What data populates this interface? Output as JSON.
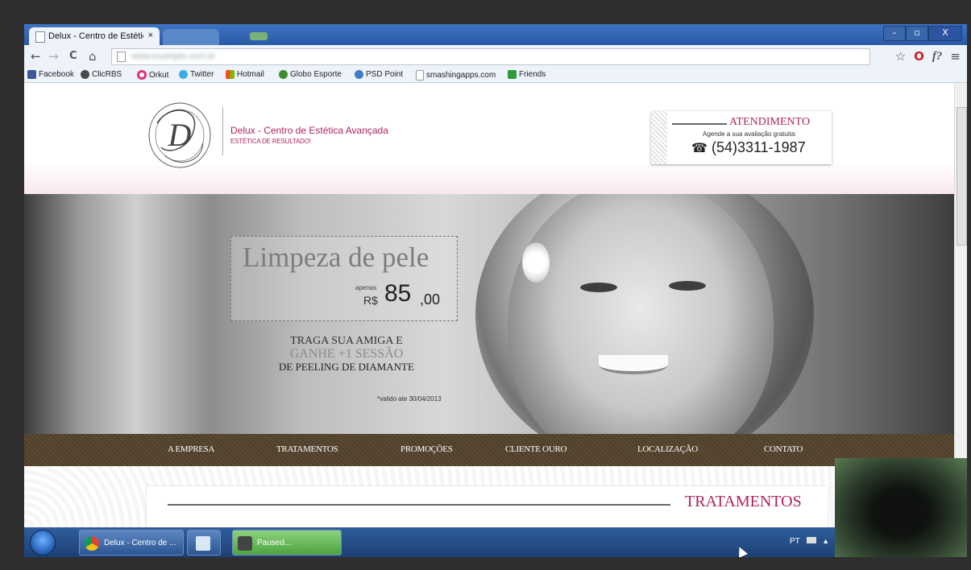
{
  "browser": {
    "tab_title": "Delux - Centro de Estétic",
    "tab_close": "×",
    "window_buttons": {
      "minimize": "–",
      "maximize": "▫",
      "close": "X"
    },
    "nav": {
      "back": "←",
      "forward": "→",
      "reload": "C",
      "home": "⌂"
    },
    "url_blurred": "www.example.com.br",
    "toolbar_icons": {
      "star": "☆",
      "opera": "O",
      "fx": "f?",
      "menu": "≡"
    }
  },
  "bookmarks": [
    {
      "label": "Facebook",
      "color": "#3b5998"
    },
    {
      "label": "ClicRBS",
      "color": "#4a4a4a"
    },
    {
      "label": "Orkut",
      "color": "#e0307a"
    },
    {
      "label": "Twitter",
      "color": "#3aaee8"
    },
    {
      "label": "Hotmail",
      "color": "#f0a020"
    },
    {
      "label": "Globo Esporte",
      "color": "#3f8c2e"
    },
    {
      "label": "PSD Point",
      "color": "#3f7dc8"
    },
    {
      "label": "smashingapps.com",
      "color": "#ffffff"
    },
    {
      "label": "Friends",
      "color": "#2e9a3a"
    }
  ],
  "site": {
    "brand": "Delux - Centro de Estética Avançada",
    "tagline": "ESTÉTICA DE RESULTADO!",
    "logo_letter": "D",
    "atendimento": {
      "heading": "ATENDIMENTO",
      "subtitle": "Agende a sua avaliação gratuita:",
      "phone_icon": "☎",
      "phone": "(54)3311-1987"
    },
    "promo": {
      "title": "Limpeza de pele",
      "apenas": "apenas",
      "currency": "R$",
      "price": "85",
      "cents": ",00"
    },
    "offer": {
      "line1": "TRAGA SUA AMIGA E",
      "line2": "GANHE +1 SESSÃO",
      "line3": "DE PEELING DE DIAMANTE"
    },
    "validity": "*valido ate 30/04/2013",
    "menu": [
      "A EMPRESA",
      "TRATAMENTOS",
      "PROMOÇÕES",
      "CLIENTE OURO",
      "LOCALIZAÇÃO",
      "CONTATO"
    ],
    "section_title": "TRATAMENTOS"
  },
  "taskbar": {
    "chrome_task": "Delux - Centro de ...",
    "paused_task": "Paused...",
    "tray_lang": "PT",
    "tray_arrow": "▴"
  },
  "colors": {
    "accent": "#b0245e",
    "nav_brown": "#5b4a34",
    "titlebar": "#2b5aa6"
  }
}
